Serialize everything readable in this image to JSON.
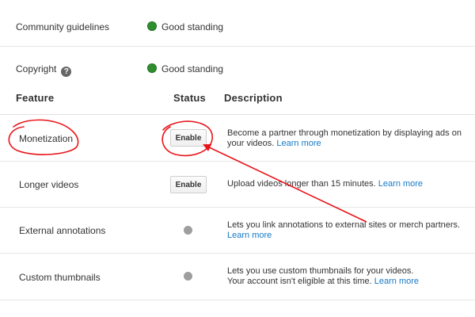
{
  "standing": {
    "community": {
      "label": "Community guidelines",
      "status": "Good standing"
    },
    "copyright": {
      "label": "Copyright",
      "help_glyph": "?",
      "status": "Good standing"
    }
  },
  "table": {
    "headers": {
      "feature": "Feature",
      "status": "Status",
      "description": "Description"
    },
    "rows": [
      {
        "feature": "Monetization",
        "button": "Enable",
        "description": "Become a partner through monetization by displaying ads on your videos.",
        "link": "Learn more"
      },
      {
        "feature": "Longer videos",
        "button": "Enable",
        "description": "Upload videos longer than 15 minutes.",
        "link": "Learn more"
      },
      {
        "feature": "External annotations",
        "description": "Lets you link annotations to external sites or merch partners.",
        "link": "Learn more"
      },
      {
        "feature": "Custom thumbnails",
        "description_line1": "Lets you use custom thumbnails for your videos.",
        "description_line2": "Your account isn't eligible at this time.",
        "link": "Learn more"
      }
    ]
  },
  "colors": {
    "good_standing_dot": "#2f8f2f",
    "unavailable_dot": "#9e9e9e",
    "link": "#167ac6",
    "annotation": "#e8141a"
  },
  "icons": {
    "good_standing": "green-status-dot-icon",
    "unavailable": "grey-status-dot-icon",
    "help": "question-mark-icon"
  }
}
